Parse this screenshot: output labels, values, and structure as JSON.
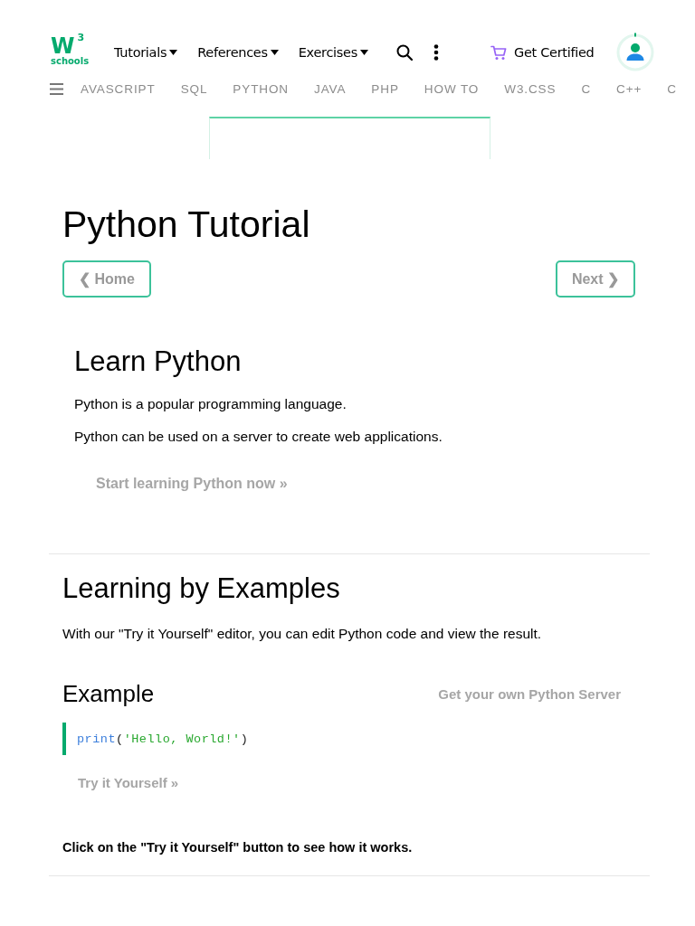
{
  "header": {
    "logo": {
      "mark": "W",
      "superscript": "3",
      "wordmark": "schools"
    },
    "menus": [
      {
        "label": "Tutorials"
      },
      {
        "label": "References"
      },
      {
        "label": "Exercises"
      }
    ],
    "certified": {
      "label": "Get Certified"
    }
  },
  "topics_nav": {
    "items": [
      {
        "label": "AVASCRIPT"
      },
      {
        "label": "SQL"
      },
      {
        "label": "PYTHON"
      },
      {
        "label": "JAVA"
      },
      {
        "label": "PHP"
      },
      {
        "label": "HOW TO"
      },
      {
        "label": "W3.CSS"
      },
      {
        "label": "C"
      },
      {
        "label": "C++"
      },
      {
        "label": "C"
      }
    ]
  },
  "page": {
    "title": "Python Tutorial",
    "prev_button": "❮ Home",
    "next_button": "Next ❯"
  },
  "learn": {
    "heading": "Learn Python",
    "paragraphs": [
      "Python is a popular programming language.",
      "Python can be used on a server to create web applications."
    ],
    "button": "Start learning Python now »"
  },
  "examples": {
    "heading": "Learning by Examples",
    "intro": "With our \"Try it Yourself\" editor, you can edit Python code and view the result.",
    "example": {
      "heading": "Example",
      "server_button": "Get your own Python Server",
      "code": [
        {
          "text": "print",
          "kind": "function"
        },
        {
          "text": "(",
          "kind": "plain"
        },
        {
          "text": "'Hello, World!'",
          "kind": "string"
        },
        {
          "text": ")",
          "kind": "plain"
        }
      ],
      "try_button": "Try it Yourself »"
    },
    "note": "Click on the \"Try it Yourself\" button to see how it works."
  }
}
